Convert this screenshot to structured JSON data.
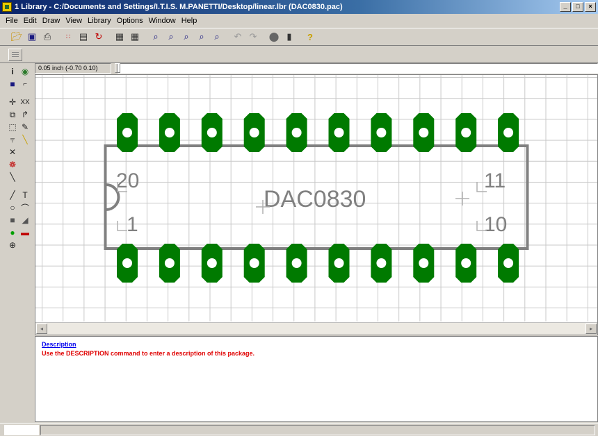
{
  "window": {
    "title": "1 Library - C:/Documents and Settings/I.T.I.S. M.PANETTI/Desktop/linear.lbr (DAC0830.pac)",
    "buttons": [
      "_",
      "□",
      "×"
    ]
  },
  "menu": [
    "File",
    "Edit",
    "Draw",
    "View",
    "Library",
    "Options",
    "Window",
    "Help"
  ],
  "toolbar_icons": [
    "open-icon",
    "save-icon",
    "print-icon",
    "ratsnest-icon",
    "layers-icon",
    "undo-icon",
    "cam-icon",
    "drc-icon",
    "zoom-fit-icon",
    "zoom-in-icon",
    "zoom-out-icon",
    "zoom-redraw-icon",
    "zoom-select-icon",
    "undo2-icon",
    "redo-icon",
    "stop-icon",
    "script-icon",
    "help-icon"
  ],
  "coords": {
    "grid": "0.05 inch (-0.70 0.10)"
  },
  "package": {
    "name": "DAC0830",
    "pin_labels": {
      "top_left": "20",
      "bottom_left": "1",
      "top_right": "11",
      "bottom_right": "10"
    },
    "pad_color": "#007a00",
    "outline_color": "#808080"
  },
  "description": {
    "heading": "Description",
    "text": "Use the DESCRIPTION command to enter a description of this package."
  },
  "colors": {
    "title_start": "#0a246a",
    "pad": "#007a00",
    "desc_link": "#0000ee",
    "desc_text": "#e00000"
  }
}
